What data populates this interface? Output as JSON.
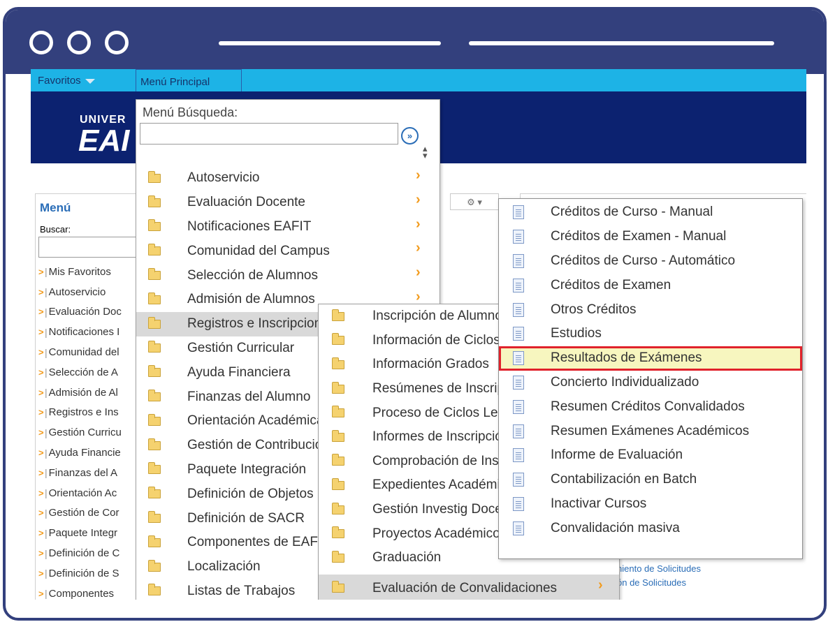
{
  "frame": {
    "accent": "#33407d"
  },
  "nav": {
    "favoritos": "Favoritos",
    "menu_principal": "Menú Principal"
  },
  "banner": {
    "logo_line1": "UNIVER",
    "logo_line2": "EAI"
  },
  "left_menu": {
    "title": "Menú",
    "buscar_label": "Buscar:",
    "items": [
      "Mis Favoritos",
      "Autoservicio",
      "Evaluación Doc",
      "Notificaciones I",
      "Comunidad del",
      "Selección de A",
      "Admisión de Al",
      "Registros e Ins",
      "Gestión Curricu",
      "Ayuda Financie",
      "Finanzas del A",
      "Orientación Ac",
      "Gestión de Cor",
      "Paquete Integr",
      "Definición de C",
      "Definición de S",
      "Componentes"
    ]
  },
  "main_menu": {
    "search_label": "Menú Búsqueda:",
    "go_icon": "double-chevron-right-icon",
    "items": [
      {
        "label": "Autoservicio",
        "chevron": true
      },
      {
        "label": "Evaluación Docente",
        "chevron": true
      },
      {
        "label": "Notificaciones EAFIT",
        "chevron": true
      },
      {
        "label": "Comunidad del Campus",
        "chevron": true
      },
      {
        "label": "Selección de Alumnos",
        "chevron": true
      },
      {
        "label": "Admisión de Alumnos",
        "chevron": true
      },
      {
        "label": "Registros e Inscripciones",
        "chevron": false
      },
      {
        "label": "Gestión Curricular",
        "chevron": false
      },
      {
        "label": "Ayuda Financiera",
        "chevron": false
      },
      {
        "label": "Finanzas del Alumno",
        "chevron": false
      },
      {
        "label": "Orientación Académica",
        "chevron": false
      },
      {
        "label": "Gestión de Contribuciones",
        "chevron": false
      },
      {
        "label": "Paquete Integración",
        "chevron": false
      },
      {
        "label": "Definición de Objetos",
        "chevron": false
      },
      {
        "label": "Definición de SACR",
        "chevron": false
      },
      {
        "label": "Componentes de EAFIT",
        "chevron": false
      },
      {
        "label": "Localización",
        "chevron": false
      },
      {
        "label": "Listas de Trabajos",
        "chevron": false
      }
    ]
  },
  "sub_menu": {
    "items": [
      "Inscripción de Alumnos",
      "Información de Ciclos",
      "Información Grados",
      "Resúmenes de Inscripción",
      "Proceso de Ciclos Lectivos",
      "Informes de Inscripción",
      "Comprobación de Inscripción",
      "Expedientes Académicos",
      "Gestión Investig Docente",
      "Proyectos Académicos",
      "Graduación",
      "Evaluación de Convalidaciones"
    ]
  },
  "sub_sub_menu": {
    "items": [
      "Créditos de Curso - Manual",
      "Créditos de Examen - Manual",
      "Créditos de Curso - Automático",
      "Créditos de Examen",
      "Otros Créditos",
      "Estudios",
      "Resultados de Exámenes",
      "Concierto Individualizado",
      "Resumen Créditos Convalidados",
      "Resumen Exámenes Académicos",
      "Informe de Evaluación",
      "Contabilización en Batch",
      "Inactivar Cursos",
      "Convalidación masiva"
    ],
    "highlight_color": "#e0222b"
  },
  "right_links": {
    "link1": "niento de Solicitudes",
    "link2": "ón de Solicitudes"
  },
  "toolbar": {
    "gear_icon": "gear-icon"
  }
}
